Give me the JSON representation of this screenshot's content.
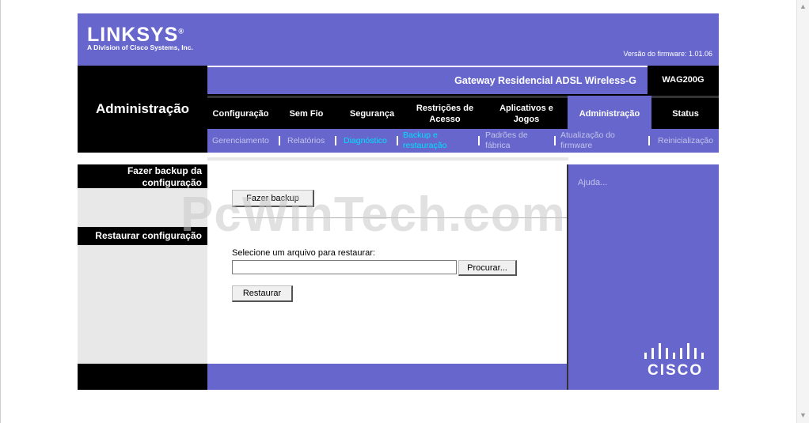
{
  "header": {
    "logo": "LINKSYS",
    "logo_mark": "®",
    "logo_subtitle": "A Division of Cisco Systems, Inc.",
    "firmware": "Versão do firmware: 1.01.06",
    "product": "Gateway Residencial ADSL Wireless-G",
    "model": "WAG200G"
  },
  "section_title": "Administração",
  "tabs": [
    {
      "label": "Configuração"
    },
    {
      "label": "Sem Fio"
    },
    {
      "label": "Segurança"
    },
    {
      "label": "Restrições de Acesso"
    },
    {
      "label": "Aplicativos e Jogos"
    },
    {
      "label": "Administração",
      "active": true
    },
    {
      "label": "Status"
    }
  ],
  "subtabs": [
    {
      "label": "Gerenciamento"
    },
    {
      "label": "Relatórios"
    },
    {
      "label": "Diagnóstico"
    },
    {
      "label": "Backup e restauração",
      "current": true
    },
    {
      "label": "Padrões de fábrica"
    },
    {
      "label": "Atualização do firmware"
    },
    {
      "label": "Reinicialização"
    }
  ],
  "left_labels": {
    "backup": "Fazer backup da configuração",
    "restore": "Restaurar configuração"
  },
  "content": {
    "backup_button": "Fazer backup",
    "select_label": "Selecione um arquivo para restaurar:",
    "file_value": "",
    "browse_button": "Procurar...",
    "restore_button": "Restaurar"
  },
  "help": "Ajuda...",
  "cisco": "CISCO",
  "watermark": "PcWinTech.com",
  "colors": {
    "brand_purple": "#6666cc",
    "current_subtab": "#00e0ff"
  }
}
